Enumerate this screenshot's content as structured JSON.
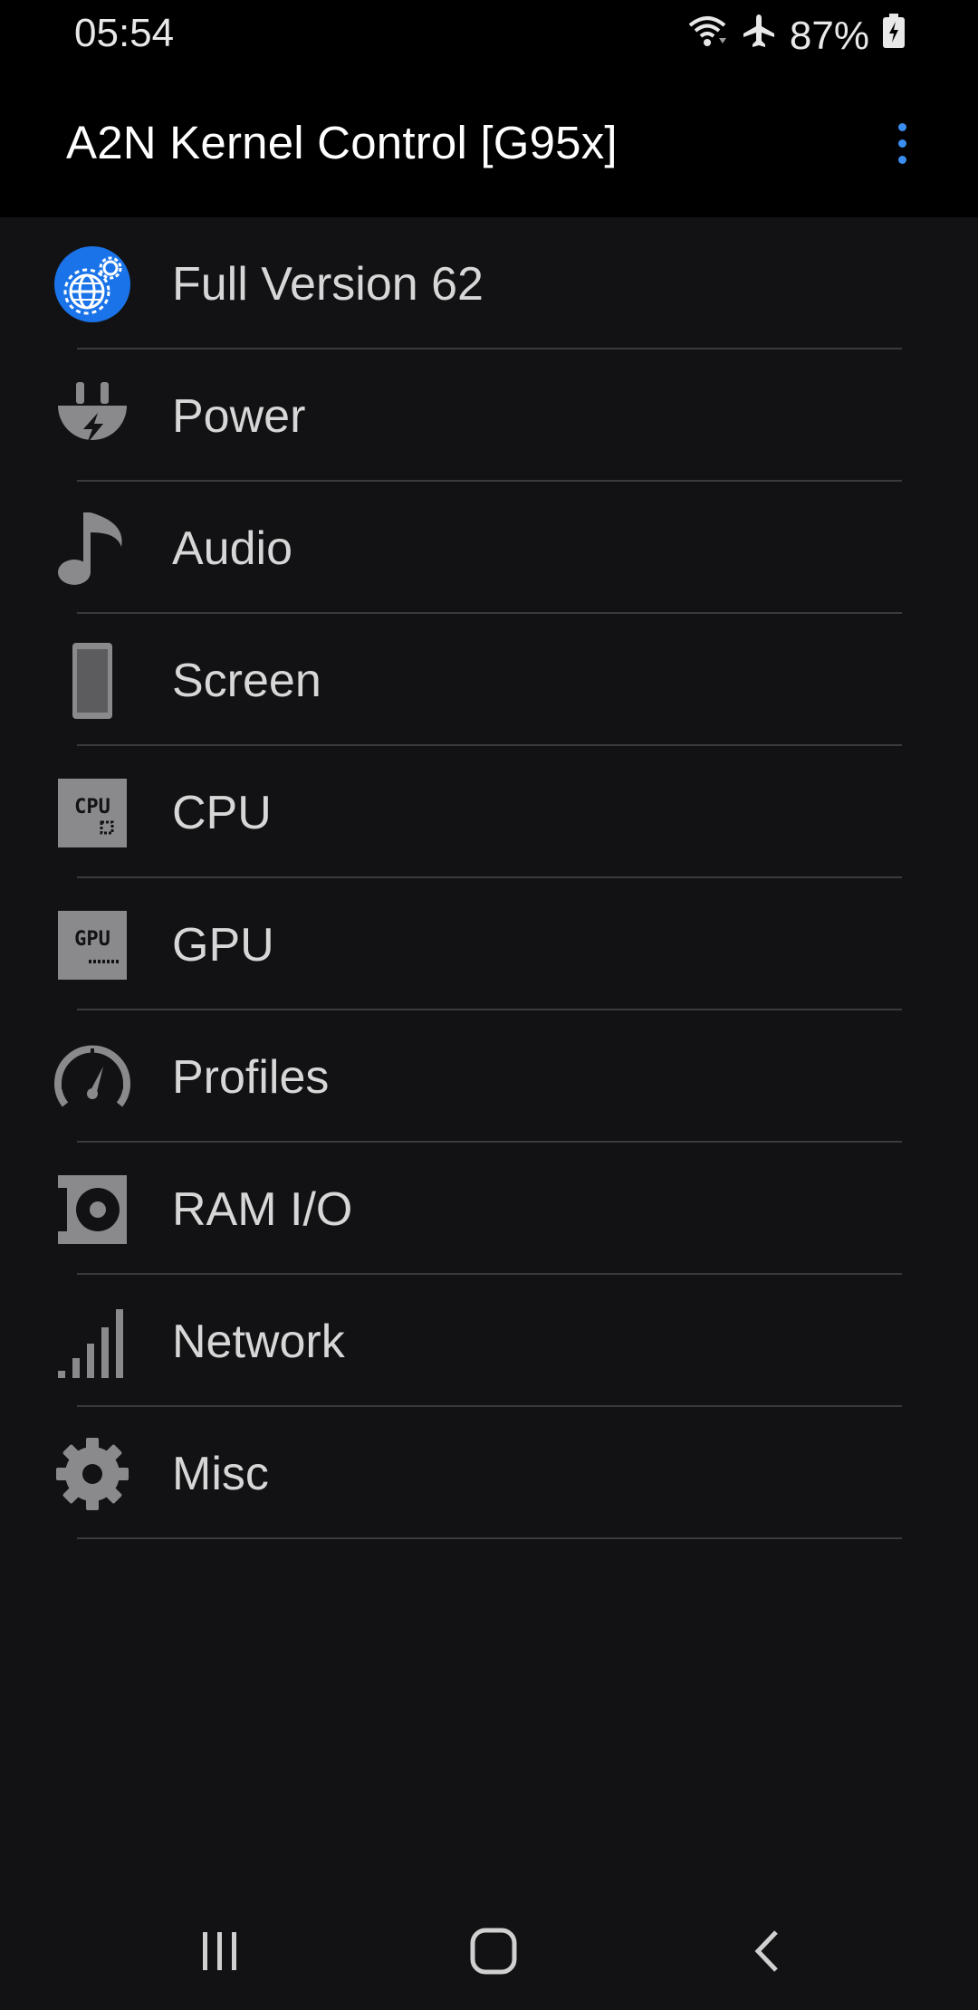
{
  "status": {
    "time": "05:54",
    "battery": "87%",
    "icons": [
      "wifi-icon",
      "airplane-icon",
      "battery-charging-icon"
    ]
  },
  "app_bar": {
    "title": "A2N Kernel Control [G95x]",
    "menu_icon": "overflow-menu-icon",
    "accent": "#3b8ef0"
  },
  "menu": {
    "items": [
      {
        "label": "Full Version 62",
        "icon": "globe-gear-icon"
      },
      {
        "label": "Power",
        "icon": "power-plug-icon"
      },
      {
        "label": "Audio",
        "icon": "music-note-icon"
      },
      {
        "label": "Screen",
        "icon": "phone-screen-icon"
      },
      {
        "label": "CPU",
        "icon": "cpu-icon"
      },
      {
        "label": "GPU",
        "icon": "gpu-icon"
      },
      {
        "label": "Profiles",
        "icon": "speedometer-icon"
      },
      {
        "label": "RAM I/O",
        "icon": "ram-disk-icon"
      },
      {
        "label": "Network",
        "icon": "signal-bars-icon"
      },
      {
        "label": "Misc",
        "icon": "gear-icon"
      }
    ]
  },
  "nav": {
    "icons": [
      "recent-apps-icon",
      "home-icon",
      "back-icon"
    ]
  },
  "colors": {
    "background": "#121214",
    "bar": "#000000",
    "icon_gray": "#8a8a8c",
    "highlight_blue": "#1a73e8"
  }
}
